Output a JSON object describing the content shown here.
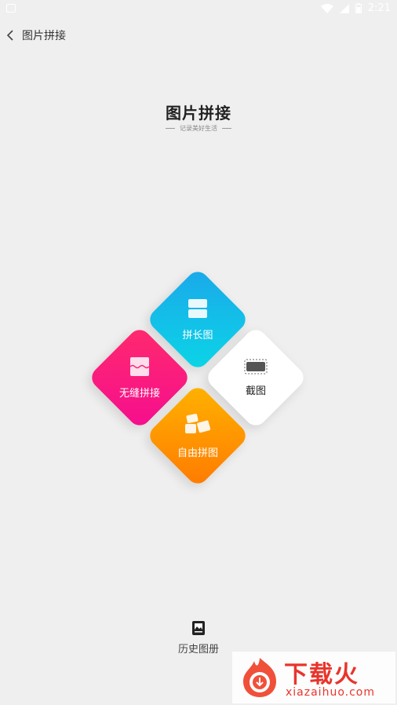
{
  "status_bar": {
    "time": "2:21"
  },
  "header": {
    "back_label": "图片拼接"
  },
  "hero": {
    "title": "图片拼接",
    "subtitle": "记录美好生活"
  },
  "tiles": {
    "long": {
      "label": "拼长图",
      "color_start": "#1aa8ea",
      "color_end": "#0bd6e6",
      "icon": "stacked-rectangles-icon"
    },
    "seamless": {
      "label": "无缝拼接",
      "color_start": "#ff2a6d",
      "color_end": "#f50d8f",
      "icon": "wavy-seam-icon"
    },
    "screenshot": {
      "label": "截图",
      "color": "#ffffff",
      "icon": "screenshot-icon"
    },
    "free": {
      "label": "自由拼图",
      "color_start": "#ffb300",
      "color_end": "#ff7a00",
      "icon": "scattered-photos-icon"
    }
  },
  "history": {
    "label": "历史图册",
    "icon": "album-icon"
  },
  "watermark": {
    "title": "下载火",
    "url": "xiazaihuo.com"
  }
}
